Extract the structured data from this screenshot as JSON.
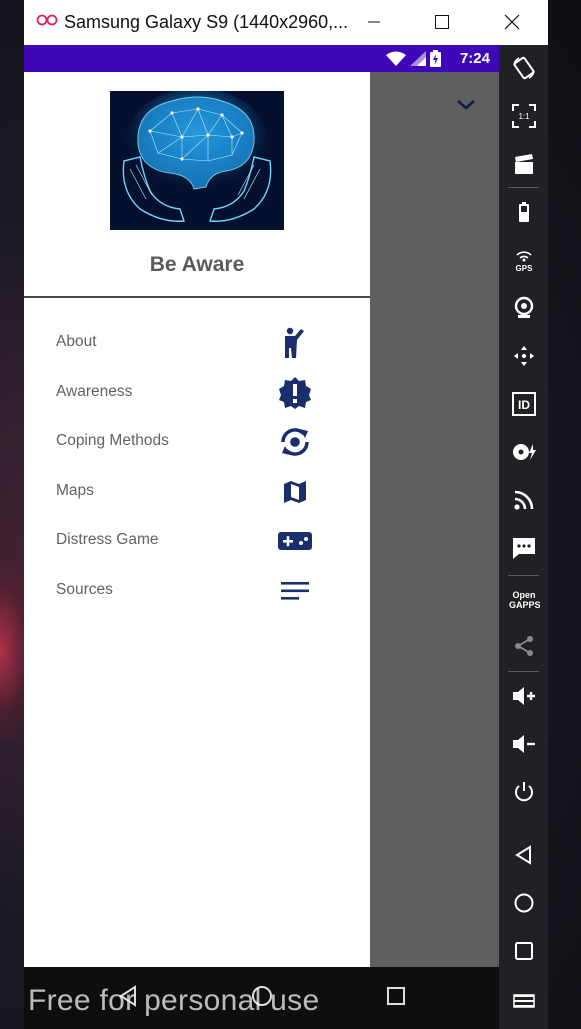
{
  "window": {
    "title": "Samsung Galaxy S9 (1440x2960,...",
    "controls": [
      "minimize",
      "maximize",
      "close"
    ]
  },
  "statusbar": {
    "time": "7:24",
    "icons": [
      "wifi-icon",
      "signal-icon",
      "battery-charging-icon"
    ]
  },
  "drawer": {
    "title": "Be Aware",
    "items": [
      {
        "label": "About",
        "icon": "person-waving-icon"
      },
      {
        "label": "Awareness",
        "icon": "alert-badge-icon"
      },
      {
        "label": "Coping Methods",
        "icon": "sync-problem-icon"
      },
      {
        "label": "Maps",
        "icon": "map-icon"
      },
      {
        "label": "Distress Game",
        "icon": "gamepad-icon"
      },
      {
        "label": "Sources",
        "icon": "notes-icon"
      }
    ]
  },
  "sidebar_tools": [
    "rotate",
    "scale",
    "screen-record",
    "battery",
    "gps",
    "camera",
    "move",
    "identifiers",
    "disk-io",
    "network",
    "sms",
    "open-gapps",
    "share",
    "volume-up",
    "volume-down",
    "power",
    "back",
    "home",
    "recent-apps",
    "menu"
  ],
  "sidebar_open_gapps": "Open GAPPS",
  "sidebar_scale": "1:1",
  "sidebar_gps": "GPS",
  "sidebar_id": "ID",
  "watermark": "Free for personal use",
  "colors": {
    "statusbar": "#3e07b8",
    "accent_icons": "#1a2e6b",
    "scrim": "#5f5f5f"
  }
}
